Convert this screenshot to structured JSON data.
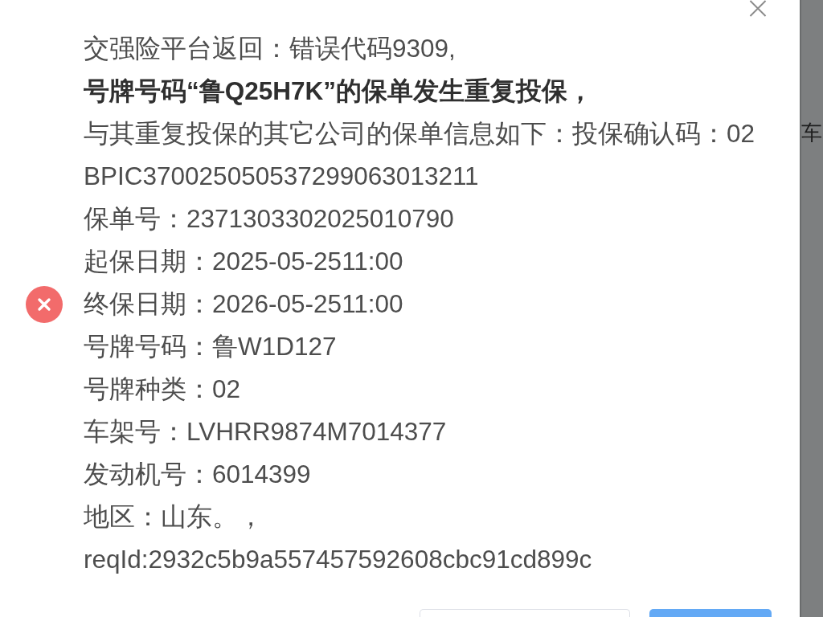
{
  "dialog": {
    "status_icon": {
      "kind": "error"
    },
    "message_lines": [
      {
        "text": "交强险平台返回：错误代码9309,",
        "bold": false
      },
      {
        "text": "号牌号码“鲁Q25H7K”的保单发生重复投保，",
        "bold": true
      },
      {
        "text": "与其重复投保的其它公司的保单信息如下：投保确认码：02",
        "bold": false
      },
      {
        "text": "BPIC370025050537299063013211",
        "bold": false
      },
      {
        "text": "保单号：2371303302025010790",
        "bold": false
      },
      {
        "text": "起保日期：2025-05-2511:00",
        "bold": false
      },
      {
        "text": "终保日期：2026-05-2511:00",
        "bold": false
      },
      {
        "text": "号牌号码：鲁W1D127",
        "bold": false
      },
      {
        "text": "号牌种类：02",
        "bold": false
      },
      {
        "text": "车架号：LVHRR9874M7014377",
        "bold": false
      },
      {
        "text": "发动机号：6014399",
        "bold": false
      },
      {
        "text": "地区：山东。，",
        "bold": false
      },
      {
        "text": "reqId:2932c5b9a557457592608cbc91cd899c",
        "bold": false
      }
    ],
    "buttons": [
      {
        "kind": "default"
      },
      {
        "kind": "primary"
      }
    ]
  },
  "backdrop": {
    "text": "车"
  }
}
